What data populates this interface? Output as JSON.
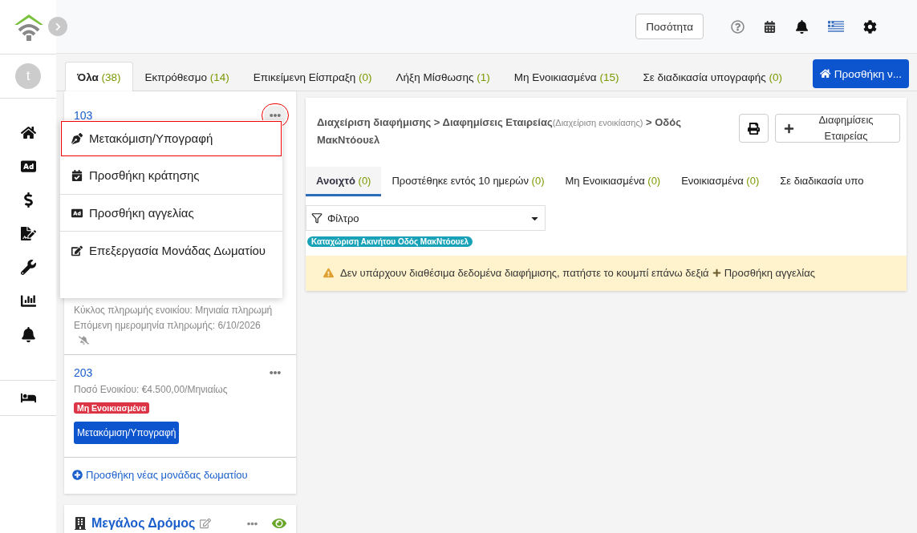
{
  "header": {
    "quantity_button": "Ποσότητα"
  },
  "sidebar": {
    "avatar": "t"
  },
  "tabs": [
    {
      "label": "Όλα",
      "count": "(38)",
      "selected": true
    },
    {
      "label": "Εκπρόθεσμο",
      "count": "(14)",
      "selected": false
    },
    {
      "label": "Επικείμενη Είσπραξη",
      "count": "(0)",
      "selected": false
    },
    {
      "label": "Λήξη Μίσθωσης",
      "count": "(1)",
      "selected": false
    },
    {
      "label": "Μη Ενοικιασμένα",
      "count": "(15)",
      "selected": false
    },
    {
      "label": "Σε διαδικασία υπογραφής",
      "count": "(0)",
      "selected": false
    }
  ],
  "add_button": "Προσθήκη ν...",
  "units": [
    {
      "number": "103",
      "menu_open": true,
      "lines": [
        "Κύκλος πληρωμής ενοικίου: Μηνιαία πληρωμή",
        "Επόμενη ημερομηνία πληρωμής:  6/10/2026"
      ],
      "muted": true
    },
    {
      "number": "203",
      "menu_open": false,
      "lines": [
        "Ποσό Ενοικίου: €4.500,00/Μηνιαίως"
      ],
      "badge": "Μη Ενοικιασμένα",
      "action": "Μετακόμιση/Υπογραφή",
      "muted": false
    }
  ],
  "context_menu": [
    {
      "kind": "pen",
      "label": "Μετακόμιση/Υπογραφή",
      "highlighted": true
    },
    {
      "kind": "calendar",
      "label": "Προσθήκη κράτησης",
      "highlighted": false
    },
    {
      "kind": "ad",
      "label": "Προσθήκη αγγελίας",
      "highlighted": false
    },
    {
      "kind": "edit",
      "label": "Επεξεργασία Μονάδας Δωματίου",
      "highlighted": false
    }
  ],
  "add_room_link": "Προσθήκη νέας μονάδας δωματίου",
  "next_property": {
    "name": "Μεγάλος Δρόμος"
  },
  "panel": {
    "breadcrumb": [
      {
        "label": "Διαχείριση διαφήμισης"
      },
      {
        "label": "Διαφημίσεις Εταιρείας",
        "note": "(Διαχείριση ενοικίασης)"
      },
      {
        "label": "Οδός ΜακΝτόουελ"
      }
    ],
    "separator": ">",
    "company_button": "Διαφημίσεις Εταιρείας",
    "tabs": [
      {
        "label": "Ανοιχτό",
        "count": "(0)",
        "selected": true
      },
      {
        "label": "Προστέθηκε εντός 10 ημερών",
        "count": "(0)",
        "selected": false
      },
      {
        "label": "Μη Ενοικιασμένα",
        "count": "(0)",
        "selected": false
      },
      {
        "label": "Ενοικιασμένα",
        "count": "(0)",
        "selected": false
      },
      {
        "label": "Σε διαδικασία υπο",
        "selected": false
      }
    ],
    "filter": "Φίλτρο",
    "tag": "Καταχώριση Ακινήτου Οδός ΜακΝτόουελ",
    "alert": {
      "text": "Δεν υπάρχουν διαθέσιμα δεδομένα διαφήμισης, πατήστε το κουμπί επάνω δεξιά",
      "action": "Προσθήκη αγγελίας"
    }
  }
}
